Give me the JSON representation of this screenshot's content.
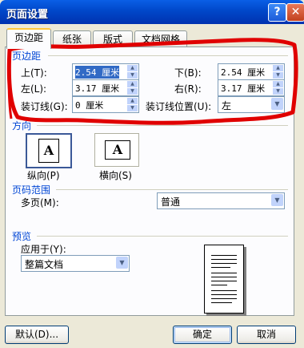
{
  "window": {
    "title": "页面设置",
    "help_label": "?",
    "close_label": "✕"
  },
  "tabs": [
    {
      "label": "页边距",
      "active": true
    },
    {
      "label": "纸张",
      "active": false
    },
    {
      "label": "版式",
      "active": false
    },
    {
      "label": "文档网格",
      "active": false
    }
  ],
  "margins": {
    "group_label": "页边距",
    "top": {
      "label": "上(T):",
      "value": "2.54 厘米"
    },
    "bottom": {
      "label": "下(B):",
      "value": "2.54 厘米"
    },
    "left": {
      "label": "左(L):",
      "value": "3.17 厘米"
    },
    "right": {
      "label": "右(R):",
      "value": "3.17 厘米"
    },
    "gutter": {
      "label": "装订线(G):",
      "value": "0 厘米"
    },
    "gutter_position": {
      "label": "装订线位置(U):",
      "value": "左"
    }
  },
  "orientation": {
    "group_label": "方向",
    "portrait_label": "纵向(P)",
    "landscape_label": "横向(S)",
    "icon_letter": "A"
  },
  "pages": {
    "group_label": "页码范围",
    "multiple_label": "多页(M):",
    "multiple_value": "普通"
  },
  "preview": {
    "group_label": "预览",
    "apply_label": "应用于(Y):",
    "apply_value": "整篇文档"
  },
  "buttons": {
    "default": "默认(D)...",
    "ok": "确定",
    "cancel": "取消"
  },
  "colors": {
    "titlebar": "#0054E3",
    "group_label": "#0046D5",
    "annotation": "#E00000"
  }
}
